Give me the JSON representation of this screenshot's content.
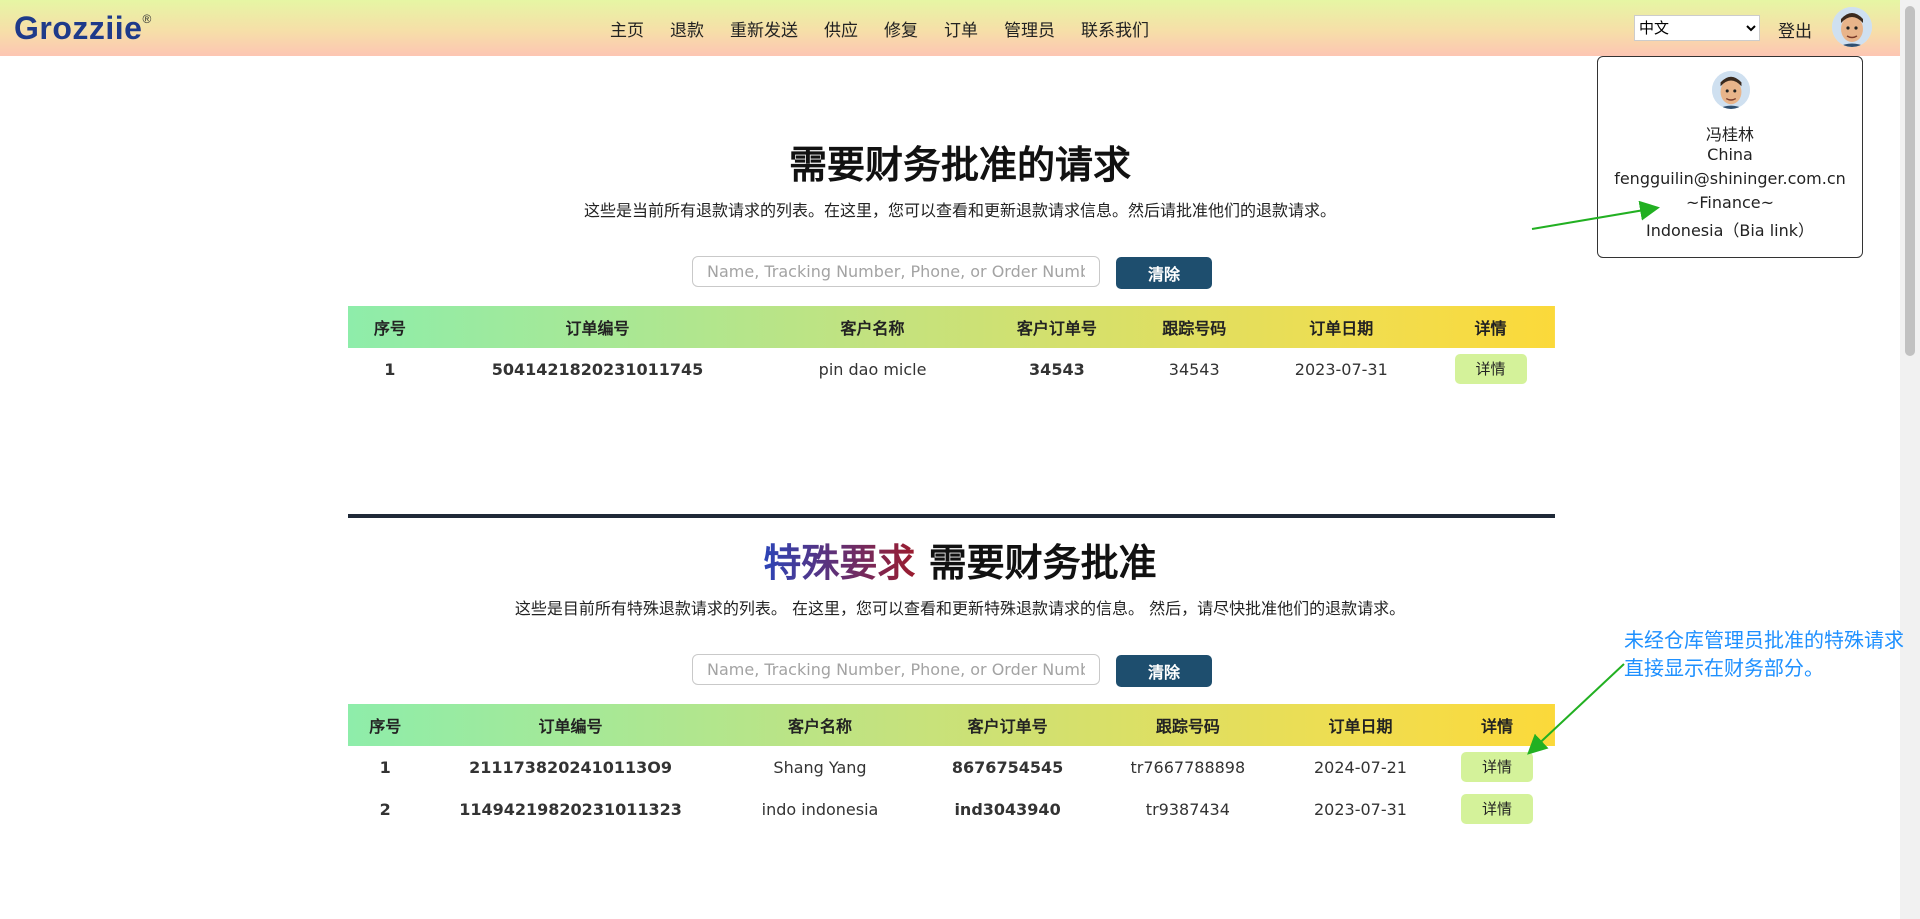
{
  "header": {
    "logo_text": "Grozziie",
    "logo_mark": "®",
    "nav": [
      "主页",
      "退款",
      "重新发送",
      "供应",
      "修复",
      "订单",
      "管理员",
      "联系我们"
    ],
    "language": "中文",
    "logout": "登出"
  },
  "profile": {
    "name": "冯桂林",
    "country": "China",
    "email": "fengguilin@shininger.com.cn",
    "role": "~Finance~",
    "extra": "Indonesia（Bia link）"
  },
  "section1": {
    "title": "需要财务批准的请求",
    "description": "这些是当前所有退款请求的列表。在这里，您可以查看和更新退款请求信息。然后请批准他们的退款请求。",
    "search_placeholder": "Name, Tracking Number, Phone, or Order Number",
    "clear_label": "清除",
    "columns": [
      "序号",
      "订单编号",
      "客户名称",
      "客户订单号",
      "跟踪号码",
      "订单日期",
      "详情"
    ],
    "rows": [
      {
        "no": "1",
        "order_no": "5041421820231011745",
        "customer": "pin dao micle",
        "customer_order": "34543",
        "tracking": "34543",
        "date": "2023-07-31",
        "detail": "详情"
      }
    ]
  },
  "section2": {
    "title_special": "特殊要求",
    "title_rest": "需要财务批准",
    "description": "这些是目前所有特殊退款请求的列表。 在这里，您可以查看和更新特殊退款请求的信息。 然后，请尽快批准他们的退款请求。",
    "search_placeholder": "Name, Tracking Number, Phone, or Order Number",
    "clear_label": "清除",
    "columns": [
      "序号",
      "订单编号",
      "客户名称",
      "客户订单号",
      "跟踪号码",
      "订单日期",
      "详情"
    ],
    "rows": [
      {
        "no": "1",
        "order_no": "2111738202410113О9",
        "customer": "Shang Yang",
        "customer_order": "8676754545",
        "tracking": "tr7667788898",
        "date": "2024-07-21",
        "detail": "详情"
      },
      {
        "no": "2",
        "order_no": "11494219820231011323",
        "customer": "indo indonesia",
        "customer_order": "ind3043940",
        "tracking": "tr9387434",
        "date": "2023-07-31",
        "detail": "详情"
      }
    ]
  },
  "annotation": "未经仓库管理员批准的特殊请求直接显示在财务部分。",
  "colors": {
    "special_blue": "#2b44b8",
    "special_red": "#9b1c2e",
    "arrow_green": "#22b022",
    "annotation_blue": "#1e90ff",
    "button_navy": "#1e4e6e"
  }
}
